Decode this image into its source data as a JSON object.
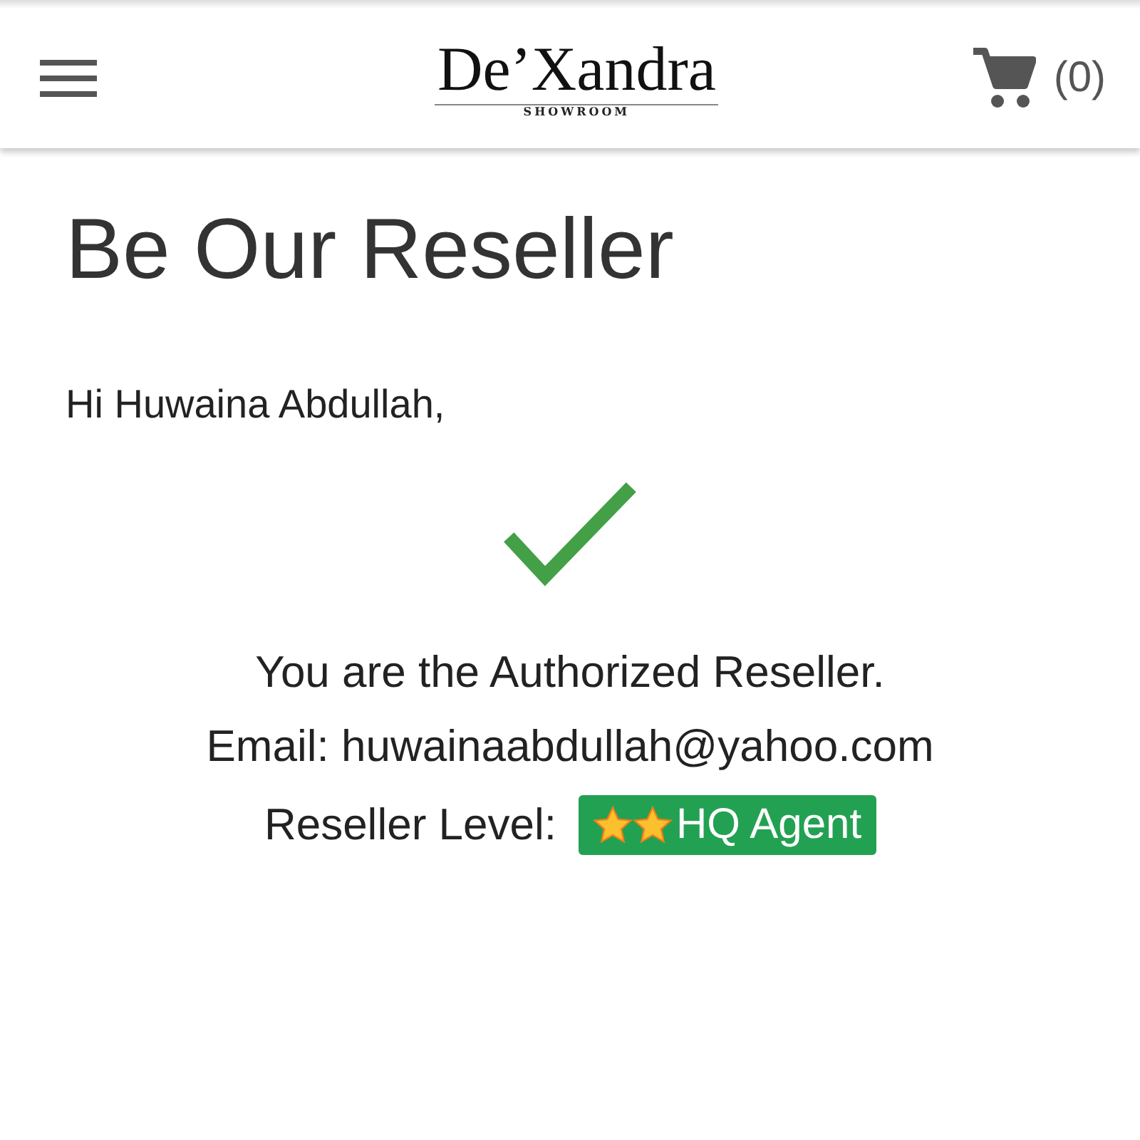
{
  "header": {
    "logo": "De’Xandra",
    "logo_subtitle": "SHOWROOM",
    "cart_count": "(0)"
  },
  "title": "Be Our Reseller",
  "greeting": "Hi Huwaina Abdullah,",
  "status": "You are the Authorized Reseller.",
  "email": "Email: huwainaabdullah@yahoo.com",
  "level": {
    "label": "Reseller Level:",
    "badge": "HQ Agent"
  }
}
